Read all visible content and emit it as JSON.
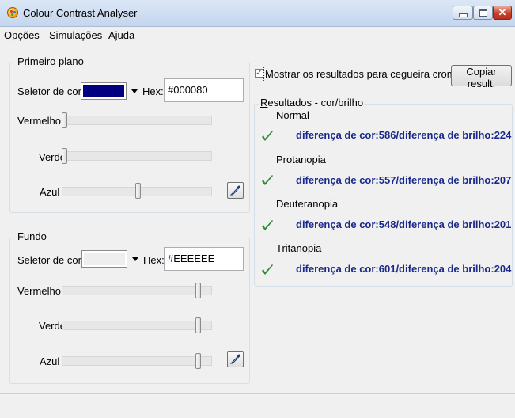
{
  "window": {
    "title": "Colour Contrast Analyser",
    "close_glyph": "✕"
  },
  "menu": {
    "items": [
      "Opções",
      "Simulações",
      "Ajuda"
    ]
  },
  "foreground": {
    "legend": "Primeiro plano",
    "picker_label": "Seletor de cor:",
    "hex_label": "Hex:",
    "hex_value": "#000080",
    "swatch_color": "#000080",
    "sliders": [
      {
        "label": "Vermelho",
        "value": 0
      },
      {
        "label": "Verde",
        "value": 0
      },
      {
        "label": "Azul",
        "value": 128
      }
    ],
    "eyedropper_icon": "eyedropper-icon"
  },
  "background": {
    "legend": "Fundo",
    "picker_label": "Seletor de cor:",
    "hex_label": "Hex:",
    "hex_value": "#EEEEEE",
    "swatch_color": "#EEEEEE",
    "sliders": [
      {
        "label": "Vermelho",
        "value": 238
      },
      {
        "label": "Verde",
        "value": 238
      },
      {
        "label": "Azul",
        "value": 238
      }
    ],
    "eyedropper_icon": "eyedropper-icon"
  },
  "options": {
    "show_colorblind_checked": true,
    "show_colorblind_label": "Mostrar os resultados para cegueira cromátic",
    "copy_button": "Copiar result."
  },
  "results": {
    "legend_mnemonic": "R",
    "legend_rest": "esultados - cor/brilho",
    "text_color": "#1b2a8a",
    "check_color": "#2e8b2e",
    "items": [
      {
        "name": "Normal",
        "text": "diferença de cor:586/diferença de brilho:224"
      },
      {
        "name": "Protanopia",
        "text": "diferença de cor:557/diferença de brilho:207"
      },
      {
        "name": "Deuteranopia",
        "text": "diferença de cor:548/diferença de brilho:201"
      },
      {
        "name": "Tritanopia",
        "text": "diferença de cor:601/diferença de brilho:204"
      }
    ]
  }
}
